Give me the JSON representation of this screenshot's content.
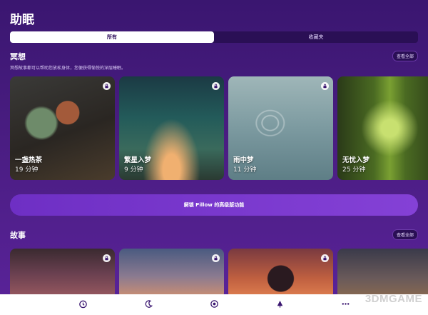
{
  "page": {
    "title": "助眠"
  },
  "segmented": {
    "tabs": [
      {
        "label": "所有",
        "active": true
      },
      {
        "label": "收藏夹",
        "active": false
      }
    ]
  },
  "meditation": {
    "title": "冥想",
    "see_all": "查看全部",
    "description": "冥想故事都可以帮助您放松身体，您便获得愉悦的深层睡眠。",
    "cards": [
      {
        "name": "一盏热茶",
        "duration": "19 分钟",
        "image": "teapot"
      },
      {
        "name": "繁星入梦",
        "duration": "9 分钟",
        "image": "night-sky"
      },
      {
        "name": "雨中梦",
        "duration": "11 分钟",
        "image": "water-ripples"
      },
      {
        "name": "无忧入梦",
        "duration": "25 分钟",
        "image": "forest-path"
      }
    ]
  },
  "unlock": {
    "label": "解锁 Pillow 的高级版功能"
  },
  "stories": {
    "title": "故事",
    "see_all": "查看全部",
    "cards": [
      {
        "image": "palm-sunset"
      },
      {
        "image": "bridge-dusk"
      },
      {
        "image": "person-sunset"
      },
      {
        "image": "dusk-street"
      }
    ]
  },
  "tabbar": {
    "items": [
      "alarm-icon",
      "sleep-moon-icon",
      "sound-icon",
      "lamp-icon",
      "more-icon"
    ]
  },
  "watermark": {
    "text": "3DMGAME"
  },
  "colors": {
    "background": "#4a1d82",
    "accent": "#7b3ad0",
    "tabbar": "#ffffff"
  }
}
